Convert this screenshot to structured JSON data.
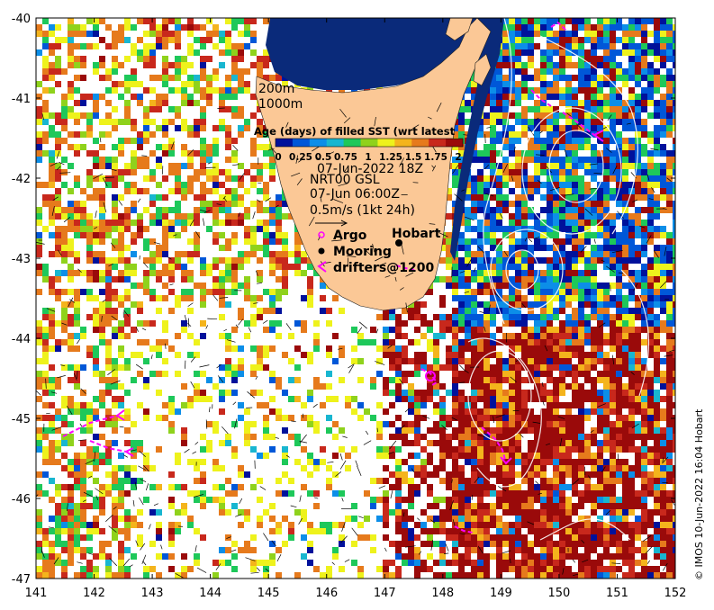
{
  "map": {
    "x_ticks": [
      "141",
      "142",
      "143",
      "144",
      "145",
      "146",
      "147",
      "148",
      "149",
      "150",
      "151",
      "152"
    ],
    "y_ticks": [
      "-40",
      "-41",
      "-42",
      "-43",
      "-44",
      "-45",
      "-46",
      "-47"
    ],
    "lon_range": [
      141,
      152
    ],
    "lat_range": [
      -47,
      -40
    ]
  },
  "isobaths": [
    "200m",
    "1000m"
  ],
  "colorbar": {
    "title": "Age (days) of filled SST (wrt latest",
    "tick_labels": [
      "0",
      "0.25",
      "0.5",
      "0.75",
      "1",
      "1.25",
      "1.5",
      "1.75",
      "2"
    ],
    "colors": [
      "#00119b",
      "#0057d8",
      "#0c8ee8",
      "#18b6d0",
      "#1ec85a",
      "#8fd21c",
      "#eef21c",
      "#f4b41c",
      "#e67a1c",
      "#c8281c",
      "#9a0a0a"
    ]
  },
  "info": {
    "timestamp": "07-Jun-2022 18Z",
    "product": "NRT00 GSL",
    "current_time": "07-Jun 06:00Z",
    "scale": "0.5m/s (1kt 24h)"
  },
  "legend": {
    "argo": "Argo",
    "mooring": "Mooring",
    "drifters": "drifters@1200"
  },
  "places": {
    "hobart": "Hobart"
  },
  "credit": "© IMOS 10-Jun-2022 16:04 Hobart",
  "colors": {
    "land": "#fbc896",
    "water_deep": "#0a2a7a",
    "argo": "#ff00ff",
    "drifter": "#ff00ff"
  }
}
